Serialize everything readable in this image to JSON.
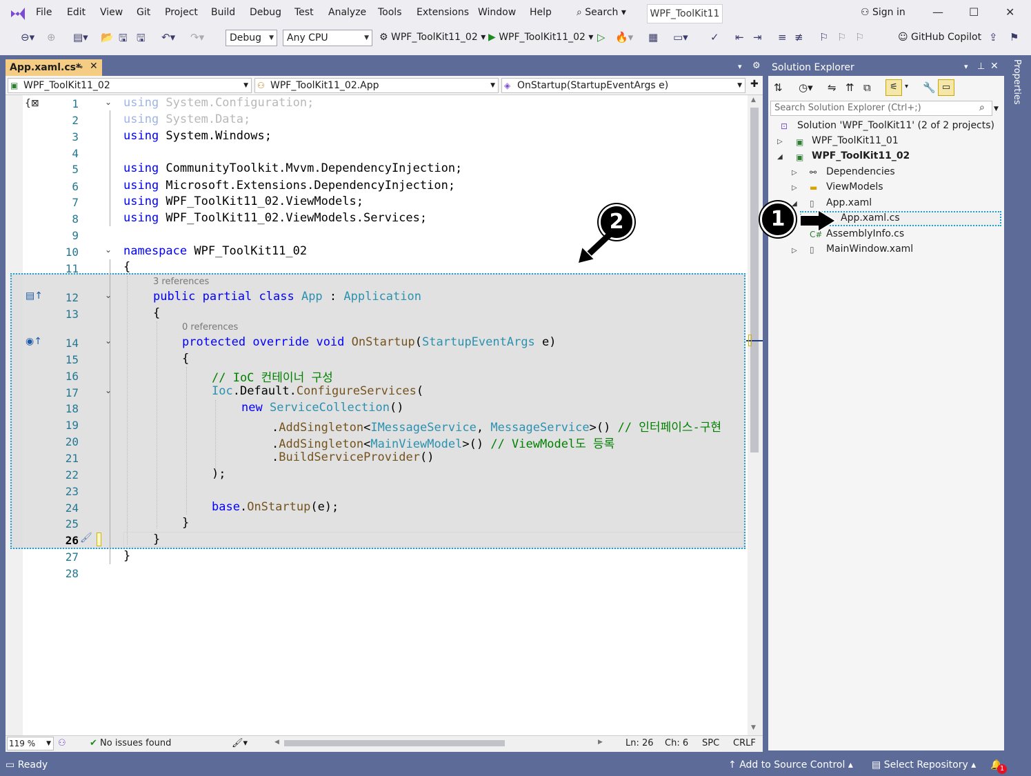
{
  "menu": {
    "items": [
      "File",
      "Edit",
      "View",
      "Git",
      "Project",
      "Build",
      "Debug",
      "Test",
      "Analyze",
      "Tools",
      "Extensions",
      "Window",
      "Help"
    ],
    "search_label": "Search",
    "solution_title": "WPF_ToolKit11",
    "sign_in": "Sign in"
  },
  "toolbar": {
    "config": "Debug",
    "platform": "Any CPU",
    "startup_project": "WPF_ToolKit11_02",
    "run_target": "WPF_ToolKit11_02",
    "copilot": "GitHub Copilot"
  },
  "document_tab": {
    "label": "App.xaml.cs*"
  },
  "navbar": {
    "project": "WPF_ToolKit11_02",
    "type": "WPF_ToolKit11_02.App",
    "member": "OnStartup(StartupEventArgs e)"
  },
  "editor": {
    "line_numbers": [
      "1",
      "2",
      "3",
      "4",
      "5",
      "6",
      "7",
      "8",
      "9",
      "10",
      "11",
      "12",
      "13",
      "14",
      "15",
      "16",
      "17",
      "18",
      "19",
      "20",
      "21",
      "22",
      "23",
      "24",
      "25",
      "26",
      "27",
      "28"
    ],
    "code": {
      "l1_kw": "using",
      "l1_rest": " System.Configuration;",
      "l2_kw": "using",
      "l2_rest": " System.Data;",
      "l3_kw": "using",
      "l3_rest": " System.Windows;",
      "l5_kw": "using",
      "l5_rest": " CommunityToolkit.Mvvm.DependencyInjection;",
      "l6_kw": "using",
      "l6_rest": " Microsoft.Extensions.DependencyInjection;",
      "l7_kw": "using",
      "l7_rest": " WPF_ToolKit11_02.ViewModels;",
      "l8_kw": "using",
      "l8_rest": " WPF_ToolKit11_02.ViewModels.Services;",
      "l10_kw": "namespace",
      "l10_rest": " WPF_ToolKit11_02",
      "l11": "{",
      "l12_kw": "public partial class",
      "l12_type": "App",
      "l12_colon": " : ",
      "l12_base": "Application",
      "l13": "{",
      "l14_kw": "protected override void",
      "l14_fn": "OnStartup",
      "l14_paren": "(",
      "l14_type": "StartupEventArgs",
      "l14_rest": " e)",
      "l15": "{",
      "l16": "// IoC 컨테이너 구성",
      "l17_type": "Ioc",
      "l17_mid": ".Default.",
      "l17_fn": "ConfigureServices",
      "l17_end": "(",
      "l18_kw": "new",
      "l18_type": "ServiceCollection",
      "l18_end": "()",
      "l19_a": ".",
      "l19_fn": "AddSingleton",
      "l19_lt": "<",
      "l19_t1": "IMessageService",
      "l19_c": ", ",
      "l19_t2": "MessageService",
      "l19_gt": ">() ",
      "l19_cm": "// 인터페이스-구현",
      "l20_a": ".",
      "l20_fn": "AddSingleton",
      "l20_lt": "<",
      "l20_t1": "MainViewModel",
      "l20_gt": ">() ",
      "l20_cm": "// ViewModel도 등록",
      "l21_a": ".",
      "l21_fn": "BuildServiceProvider",
      "l21_end": "()",
      "l22": ");",
      "l24_kw": "base",
      "l24_dot": ".",
      "l24_fn": "OnStartup",
      "l24_end": "(e);",
      "l25": "}",
      "l26": "}",
      "l27": "}"
    },
    "codelens_class": "3 references",
    "codelens_method": "0 references"
  },
  "editor_status": {
    "zoom": "119 %",
    "issues": "No issues found",
    "line": "Ln: 26",
    "col": "Ch: 6",
    "whitespace": "SPC",
    "line_ending": "CRLF"
  },
  "solution_explorer": {
    "title": "Solution Explorer",
    "search_placeholder": "Search Solution Explorer (Ctrl+;)",
    "solution": "Solution 'WPF_ToolKit11' (2 of 2 projects)",
    "project1": "WPF_ToolKit11_01",
    "project2": "WPF_ToolKit11_02",
    "dependencies": "Dependencies",
    "viewmodels": "ViewModels",
    "app_xaml": "App.xaml",
    "app_xaml_cs": "App.xaml.cs",
    "assemblyinfo": "AssemblyInfo.cs",
    "mainwindow": "MainWindow.xaml"
  },
  "properties_tab": "Properties",
  "callouts": {
    "one": "1",
    "two": "2"
  },
  "statusbar": {
    "ready": "Ready",
    "source_control": "Add to Source Control",
    "repository": "Select Repository",
    "notifications": "1"
  }
}
